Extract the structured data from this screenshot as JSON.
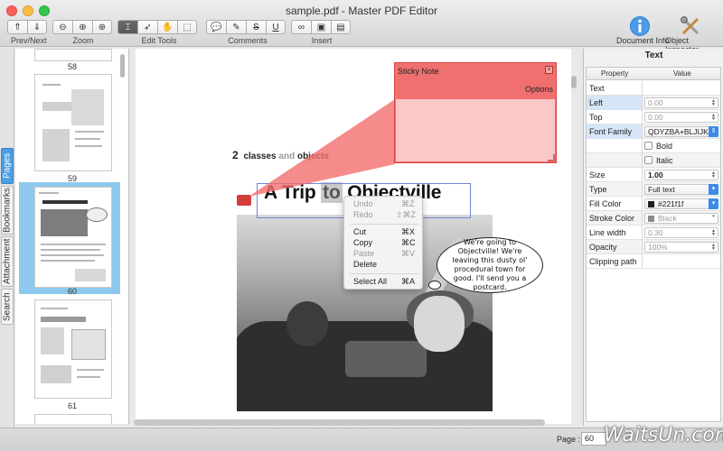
{
  "window": {
    "title": "sample.pdf - Master PDF Editor"
  },
  "toolbar": {
    "groups": [
      {
        "label": "Prev/Next"
      },
      {
        "label": "Zoom"
      },
      {
        "label": "Edit Tools"
      },
      {
        "label": "Comments"
      },
      {
        "label": "Insert"
      }
    ],
    "document_info": "Document Info",
    "object_inspector": "Object Inspector"
  },
  "side_tabs": [
    "Pages",
    "Bookmarks",
    "Attachment",
    "Search"
  ],
  "thumbnails": {
    "page_numbers": [
      "58",
      "59",
      "60",
      "61"
    ],
    "selected_page": "60"
  },
  "document": {
    "chapter_num": "2",
    "chapter_text_1": "classes",
    "chapter_text_2": "and",
    "chapter_text_3": "objects",
    "heading_pre": "A Trip ",
    "heading_sel": "to",
    "heading_post": " Objectville",
    "speech_bubble": "We're going to Objectville! We're leaving this dusty ol' procedural town for good. I'll send you a postcard."
  },
  "sticky_note": {
    "title": "Sticky Note",
    "options": "Options",
    "close_glyph": "×"
  },
  "context_menu": {
    "undo": {
      "label": "Undo",
      "shortcut": "⌘Z"
    },
    "redo": {
      "label": "Redo",
      "shortcut": "⇧⌘Z"
    },
    "cut": {
      "label": "Cut",
      "shortcut": "⌘X"
    },
    "copy": {
      "label": "Copy",
      "shortcut": "⌘C"
    },
    "paste": {
      "label": "Paste",
      "shortcut": "⌘V"
    },
    "delete": {
      "label": "Delete"
    },
    "select_all": {
      "label": "Select All",
      "shortcut": "⌘A"
    }
  },
  "inspector": {
    "title": "Text",
    "col_property": "Property",
    "col_value": "Value",
    "rows": {
      "text": {
        "name": "Text",
        "value": ""
      },
      "left": {
        "name": "Left",
        "value": "0.00"
      },
      "top": {
        "name": "Top",
        "value": "0.00"
      },
      "font_family": {
        "name": "Font Family",
        "value": "QDYZBA+BLJIJK"
      },
      "bold": {
        "label": "Bold"
      },
      "italic": {
        "label": "Italic"
      },
      "size": {
        "name": "Size",
        "value": "1.00"
      },
      "type": {
        "name": "Type",
        "value": "Full text"
      },
      "fill_color": {
        "name": "Fill Color",
        "value": "#221f1f",
        "swatch": "#221f1f"
      },
      "stroke_color": {
        "name": "Stroke Color",
        "value": "Black",
        "swatch": "#8a8a8a"
      },
      "line_width": {
        "name": "Line width",
        "value": "0.30"
      },
      "opacity": {
        "name": "Opacity",
        "value": "100%"
      },
      "clipping_path": {
        "name": "Clipping path",
        "value": ""
      }
    }
  },
  "status": {
    "page_label": "Page :",
    "page_value": "60"
  },
  "watermark": "WaitsUn.com",
  "colors": {
    "sticky": "#f07070",
    "selection": "#8dc9ec",
    "accent": "#3b8ae8",
    "note_icon": "#d63b3b"
  }
}
